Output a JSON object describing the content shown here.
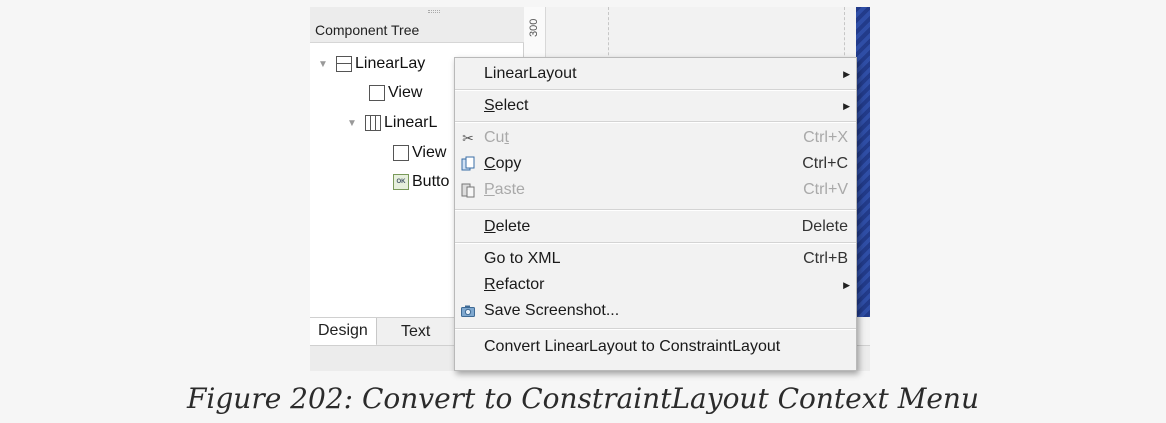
{
  "tree": {
    "title": "Component Tree",
    "rows": [
      {
        "label": "LinearLay",
        "icon": "horizontal-linear-layout-icon"
      },
      {
        "label": "View",
        "icon": "view-icon"
      },
      {
        "label": "LinearL",
        "icon": "vertical-linear-layout-icon"
      },
      {
        "label": "View",
        "icon": "view-icon"
      },
      {
        "label": "Butto",
        "icon": "button-icon",
        "icon_text": "OK"
      }
    ],
    "tabs": {
      "design": "Design",
      "text": "Text"
    }
  },
  "canvas": {
    "ruler_label": "300"
  },
  "menu": {
    "items": [
      {
        "pre": "",
        "u": "",
        "post": "LinearLayout",
        "shortcut": "",
        "submenu": true
      },
      {
        "pre": "",
        "u": "S",
        "post": "elect",
        "shortcut": "",
        "submenu": true
      },
      {
        "pre": "Cu",
        "u": "t",
        "post": "",
        "shortcut": "Ctrl+X",
        "disabled": true,
        "icon": "scissors-icon"
      },
      {
        "pre": "",
        "u": "C",
        "post": "opy",
        "shortcut": "Ctrl+C",
        "icon": "copy-icon"
      },
      {
        "pre": "",
        "u": "P",
        "post": "aste",
        "shortcut": "Ctrl+V",
        "disabled": true,
        "icon": "paste-icon"
      },
      {
        "pre": "",
        "u": "D",
        "post": "elete",
        "shortcut": "Delete"
      },
      {
        "pre": "",
        "u": "",
        "post": "Go to XML",
        "shortcut": "Ctrl+B"
      },
      {
        "pre": "",
        "u": "R",
        "post": "efactor",
        "shortcut": "",
        "submenu": true
      },
      {
        "pre": "",
        "u": "",
        "post": "Save Screenshot...",
        "shortcut": "",
        "icon": "camera-icon"
      },
      {
        "pre": "",
        "u": "",
        "post": "Convert LinearLayout to ConstraintLayout",
        "shortcut": ""
      }
    ],
    "submenu_glyph": "▶"
  },
  "caption": "Figure 202: Convert to ConstraintLayout Context Menu",
  "colors": {
    "blueprint": "#223b8a",
    "menu_bg": "#f2f2f2",
    "disabled_text": "#a9a9a9"
  }
}
